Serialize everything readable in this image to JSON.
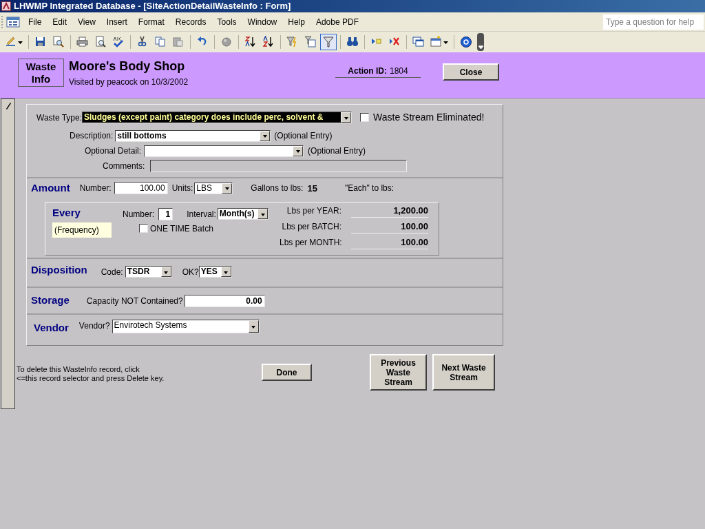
{
  "window": {
    "title": "LHWMP Integrated Database - [SiteActionDetailWasteInfo : Form]"
  },
  "menu": [
    "File",
    "Edit",
    "View",
    "Insert",
    "Format",
    "Records",
    "Tools",
    "Window",
    "Help",
    "Adobe PDF"
  ],
  "help_box": {
    "placeholder": "Type a question for help"
  },
  "toolbar": [
    {
      "kind": "design",
      "pressed": false
    },
    {
      "kind": "separator"
    },
    {
      "kind": "save",
      "pressed": false
    },
    {
      "kind": "file-search",
      "pressed": false
    },
    {
      "kind": "separator"
    },
    {
      "kind": "print",
      "pressed": false
    },
    {
      "kind": "preview",
      "pressed": false
    },
    {
      "kind": "spelling",
      "pressed": false
    },
    {
      "kind": "separator"
    },
    {
      "kind": "cut",
      "pressed": false
    },
    {
      "kind": "copy",
      "pressed": false
    },
    {
      "kind": "paste",
      "pressed": false
    },
    {
      "kind": "separator"
    },
    {
      "kind": "undo",
      "pressed": false
    },
    {
      "kind": "separator"
    },
    {
      "kind": "links",
      "pressed": false
    },
    {
      "kind": "separator"
    },
    {
      "kind": "sort-asc",
      "pressed": false
    },
    {
      "kind": "sort-desc",
      "pressed": false
    },
    {
      "kind": "separator"
    },
    {
      "kind": "filter-selection",
      "pressed": false
    },
    {
      "kind": "filter-form",
      "pressed": false
    },
    {
      "kind": "filter",
      "pressed": true
    },
    {
      "kind": "separator"
    },
    {
      "kind": "find",
      "pressed": false
    },
    {
      "kind": "separator"
    },
    {
      "kind": "new-record",
      "pressed": false
    },
    {
      "kind": "delete-record",
      "pressed": false
    },
    {
      "kind": "separator"
    },
    {
      "kind": "windows",
      "pressed": false
    },
    {
      "kind": "new-object",
      "pressed": false
    },
    {
      "kind": "separator"
    },
    {
      "kind": "help",
      "pressed": false
    }
  ],
  "header": {
    "badge": "Waste Info",
    "site": "Moore's Body Shop",
    "visit": "Visited by peacock on 10/3/2002",
    "action_label": "Action ID:",
    "action_id": "1804",
    "close": "Close"
  },
  "waste": {
    "type_label": "Waste Type:",
    "type_value": "Sludges (except paint) category does include perc, solvent &",
    "type_highlighted": true,
    "eliminated": {
      "label": "Waste Stream Eliminated!",
      "checked": false
    },
    "description": {
      "label": "Description:",
      "value": "still bottoms",
      "note": "(Optional Entry)"
    },
    "detail": {
      "label": "Optional Detail:",
      "note": "(Optional Entry)"
    },
    "comments": {
      "label": "Comments:"
    }
  },
  "amount": {
    "title": "Amount",
    "number_label": "Number:",
    "number": "100.00",
    "units_label": "Units:",
    "units": "LBS",
    "gallons_label": "Gallons to lbs:",
    "gallons": "15",
    "each_label": "\"Each\" to lbs:"
  },
  "every": {
    "title": "Every",
    "frequency": "(Frequency)",
    "number_label": "Number:",
    "number": "1",
    "interval_label": "Interval:",
    "interval": "Month(s)",
    "one_time": {
      "label": "ONE TIME Batch",
      "checked": false
    },
    "totals": [
      {
        "label": "Lbs per YEAR:",
        "value": "1,200.00"
      },
      {
        "label": "Lbs per BATCH:",
        "value": "100.00"
      },
      {
        "label": "Lbs per MONTH:",
        "value": "100.00"
      }
    ]
  },
  "disposition": {
    "title": "Disposition",
    "code_label": "Code:",
    "code": "TSDR",
    "ok_label": "OK?",
    "ok": "YES"
  },
  "storage": {
    "title": "Storage",
    "label": "Capacity NOT Contained?",
    "value": "0.00"
  },
  "vendor": {
    "title": "Vendor",
    "label": "Vendor?",
    "value": "Envirotech Systems"
  },
  "footer": {
    "delete_note": [
      "To delete this WasteInfo record, click",
      "<=this record selector and press Delete key."
    ],
    "done": "Done",
    "previous": "Previous Waste Stream",
    "next": "Next Waste Stream"
  }
}
